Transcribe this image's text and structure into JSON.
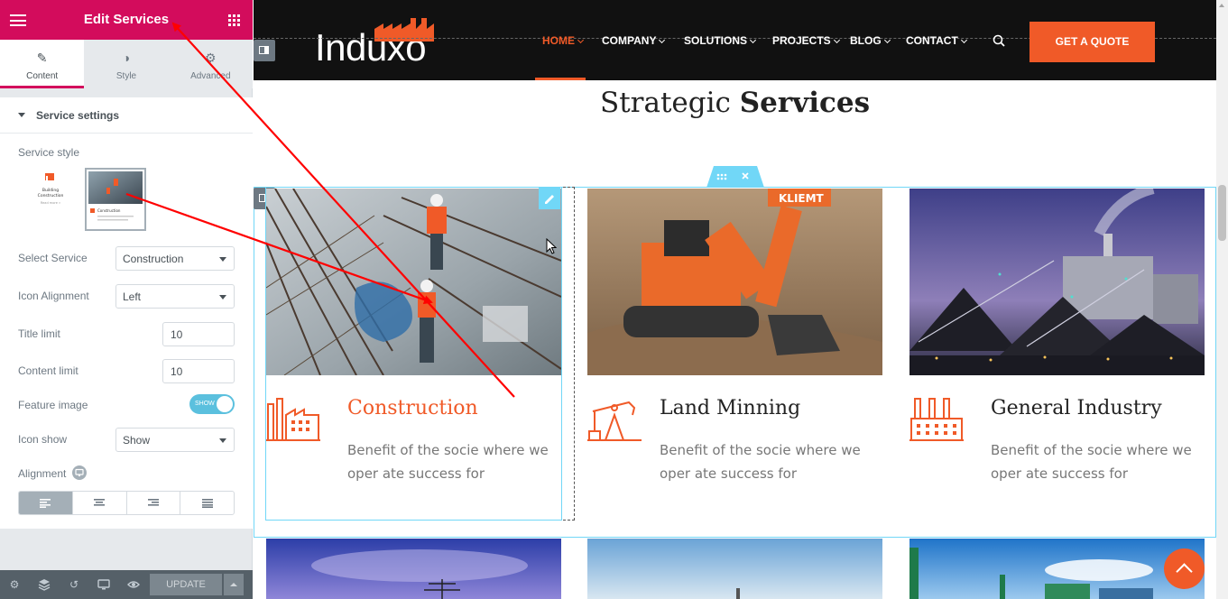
{
  "panel": {
    "title": "Edit Services",
    "tabs": [
      {
        "label": "Content",
        "icon": "pencil-icon"
      },
      {
        "label": "Style",
        "icon": "contrast-icon"
      },
      {
        "label": "Advanced",
        "icon": "gear-icon"
      }
    ],
    "section_title": "Service settings",
    "service_style_label": "Service style",
    "style_options": [
      {
        "title": "Building Construction",
        "link": "Read more »"
      },
      {
        "title": "Construction",
        "selected": true
      }
    ],
    "fields": {
      "select_service": {
        "label": "Select Service",
        "value": "Construction"
      },
      "icon_alignment": {
        "label": "Icon Alignment",
        "value": "Left"
      },
      "title_limit": {
        "label": "Title limit",
        "value": "10"
      },
      "content_limit": {
        "label": "Content limit",
        "value": "10"
      },
      "feature_image": {
        "label": "Feature image",
        "toggle_text": "SHOW",
        "on": true
      },
      "icon_show": {
        "label": "Icon show",
        "value": "Show"
      },
      "alignment": {
        "label": "Alignment",
        "options": [
          "left",
          "center",
          "right",
          "justify"
        ],
        "selected": "left"
      }
    },
    "footer": {
      "update_label": "UPDATE"
    }
  },
  "site": {
    "logo": "Induxo",
    "menu": [
      {
        "label": "HOME",
        "active": true
      },
      {
        "label": "COMPANY"
      },
      {
        "label": "SOLUTIONS"
      },
      {
        "label": "PROJECTS"
      },
      {
        "label": "BLOG"
      },
      {
        "label": "CONTACT"
      }
    ],
    "cta": "GET A QUOTE",
    "heading_light": "Strategic",
    "heading_bold": "Services",
    "services": [
      {
        "title": "Construction",
        "text": "Benefit of the socie where we oper ate success for",
        "icon": "factory-icon",
        "highlight": true
      },
      {
        "title": "Land Minning",
        "text": "Benefit of the socie where we oper ate success for",
        "icon": "oil-pump-icon",
        "highlight": false
      },
      {
        "title": "General Industry",
        "text": "Benefit of the socie where we oper ate success for",
        "icon": "industry-icon",
        "highlight": false
      }
    ]
  },
  "colors": {
    "brand_pink": "#d30c5c",
    "accent_orange": "#f05a28",
    "editor_blue": "#71d7f7",
    "annotation_red": "#ff0000"
  }
}
